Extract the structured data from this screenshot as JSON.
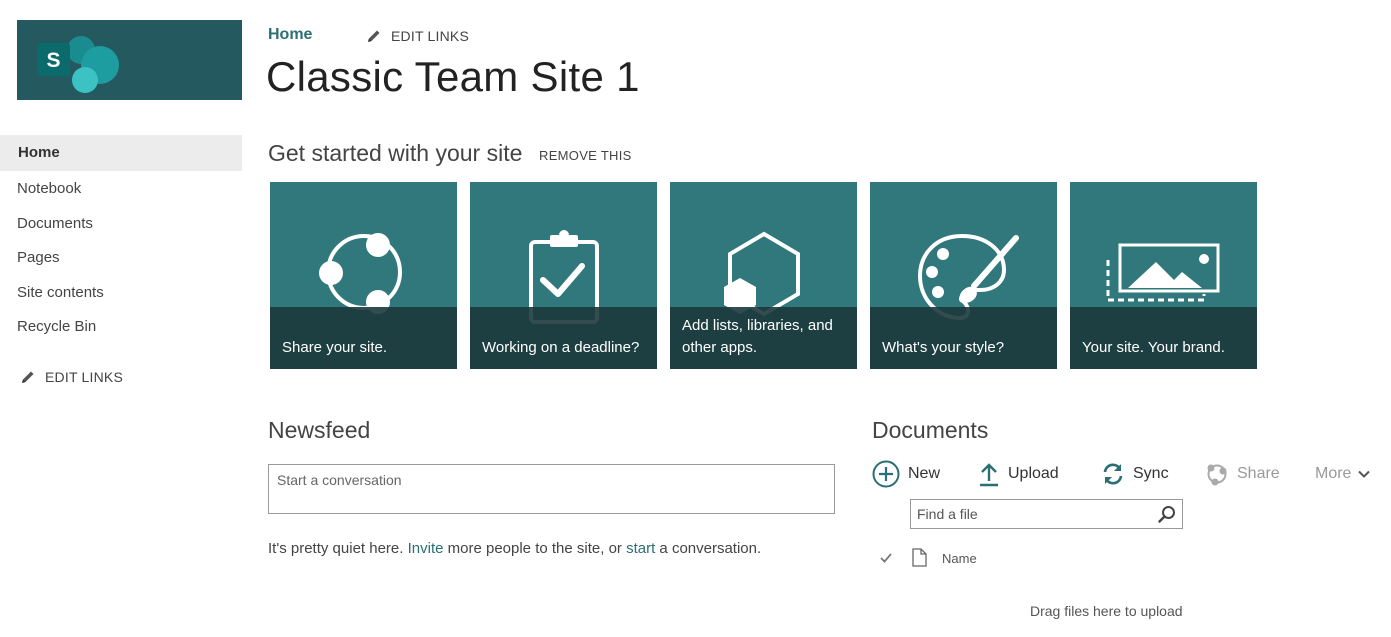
{
  "site": {
    "breadcrumb_home": "Home",
    "top_edit_links": "EDIT LINKS",
    "title": "Classic Team Site 1",
    "logo_letter": "S"
  },
  "sidebar": {
    "items": [
      {
        "label": "Home",
        "active": true
      },
      {
        "label": "Notebook"
      },
      {
        "label": "Documents"
      },
      {
        "label": "Pages"
      },
      {
        "label": "Site contents"
      },
      {
        "label": "Recycle Bin"
      }
    ],
    "edit_links": "EDIT LINKS"
  },
  "get_started": {
    "heading": "Get started with your site",
    "remove": "REMOVE THIS",
    "tiles": [
      {
        "label": "Share your site.",
        "icon": "share-icon"
      },
      {
        "label": "Working on a deadline?",
        "icon": "clipboard-check-icon"
      },
      {
        "label": "Add lists, libraries, and other apps.",
        "icon": "apps-hexagon-icon"
      },
      {
        "label": "What's your style?",
        "icon": "palette-icon"
      },
      {
        "label": "Your site. Your brand.",
        "icon": "image-brand-icon"
      }
    ]
  },
  "newsfeed": {
    "heading": "Newsfeed",
    "placeholder": "Start a conversation",
    "quiet_1": "It's pretty quiet here. ",
    "invite": "Invite",
    "quiet_2": " more people to the site, or ",
    "start": "start",
    "quiet_3": " a conversation."
  },
  "documents": {
    "heading": "Documents",
    "commands": {
      "new": "New",
      "upload": "Upload",
      "sync": "Sync",
      "share": "Share",
      "more": "More"
    },
    "find_placeholder": "Find a file",
    "column_name": "Name",
    "drag_hint": "Drag files here to upload"
  },
  "colors": {
    "tile": "#31787c",
    "tile_band": "#1c383c",
    "accent": "#2b6f74",
    "logo_bg": "#245a5f"
  }
}
